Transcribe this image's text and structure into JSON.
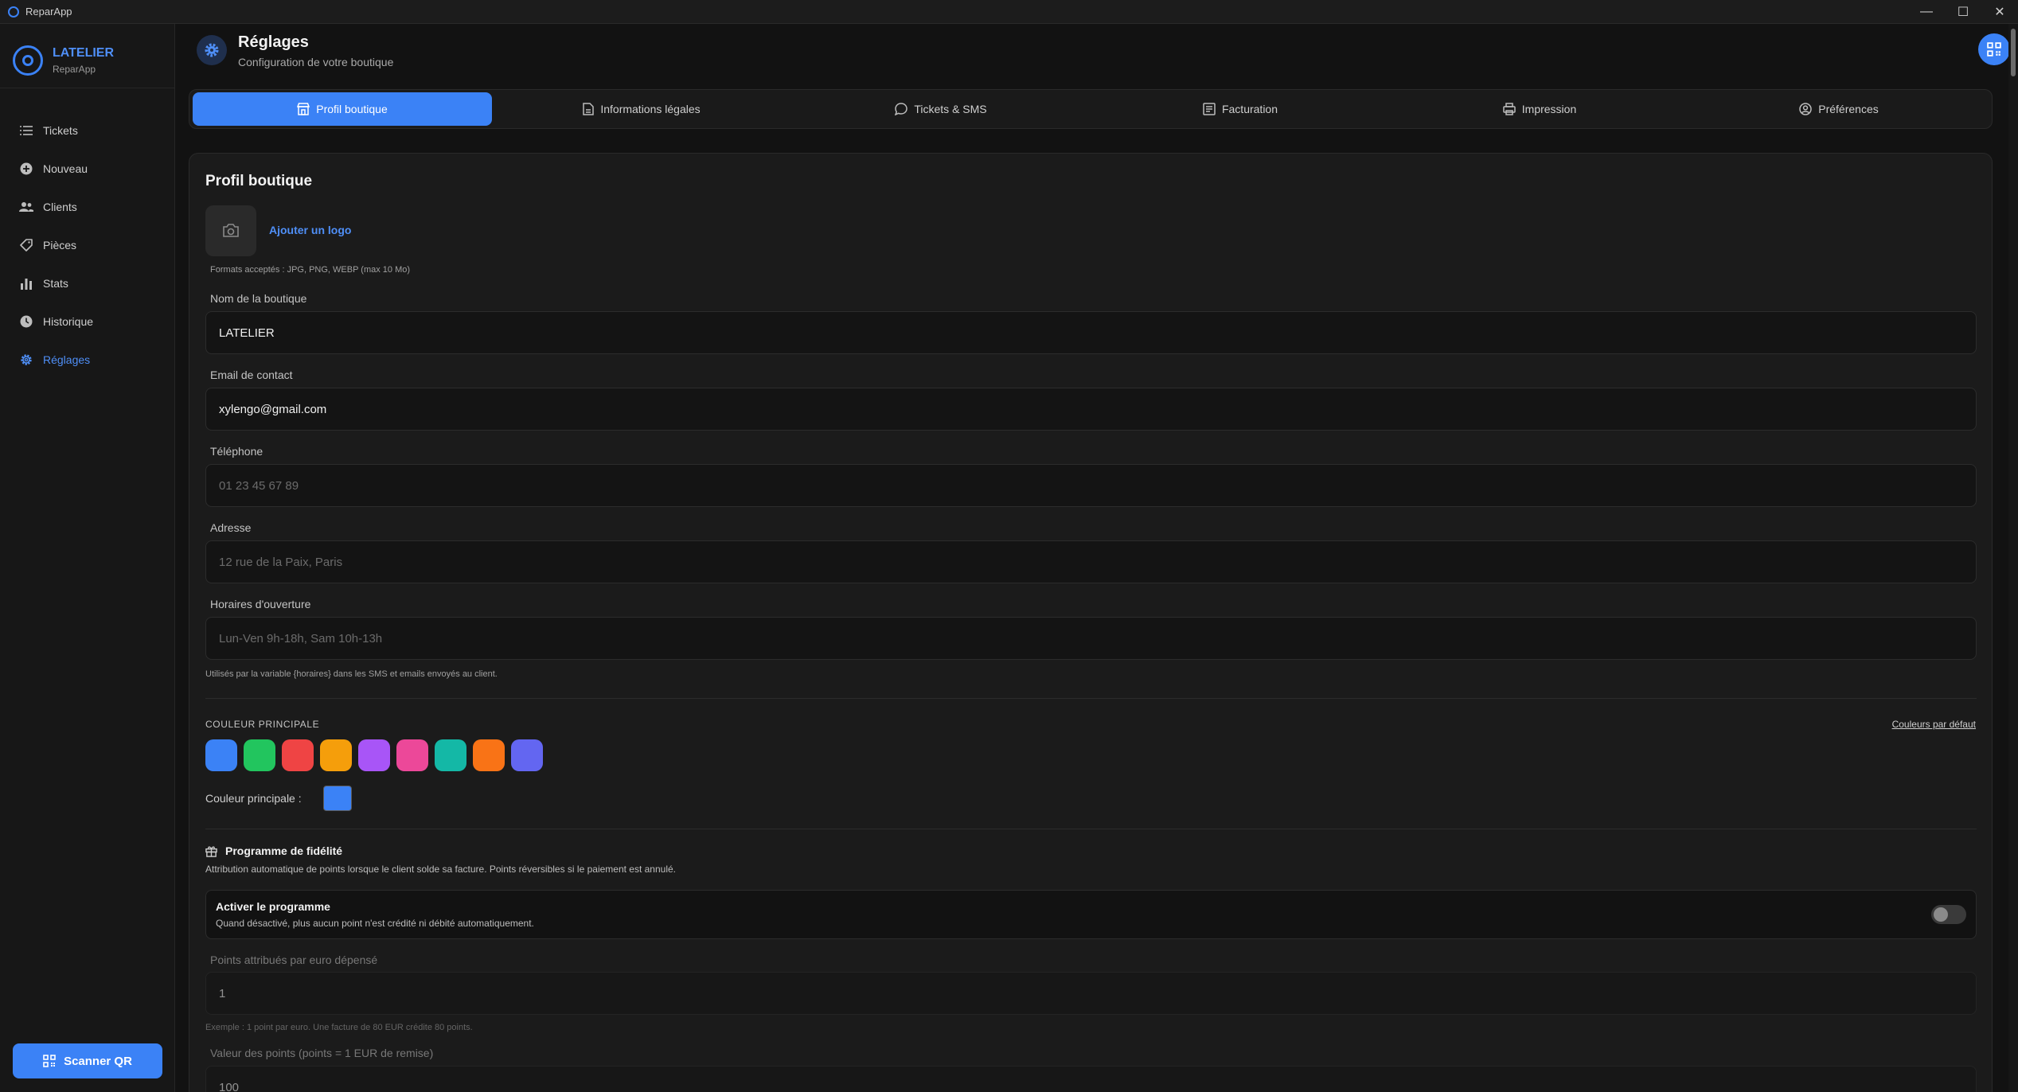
{
  "window": {
    "title": "ReparApp",
    "controls": {
      "minimize": "—",
      "maximize": "☐",
      "close": "✕"
    }
  },
  "brand": {
    "name": "LATELIER",
    "sub": "ReparApp"
  },
  "nav": [
    {
      "label": "Tickets",
      "icon": "list-icon"
    },
    {
      "label": "Nouveau",
      "icon": "plus-circle-icon"
    },
    {
      "label": "Clients",
      "icon": "users-icon"
    },
    {
      "label": "Pièces",
      "icon": "tag-icon"
    },
    {
      "label": "Stats",
      "icon": "bar-chart-icon"
    },
    {
      "label": "Historique",
      "icon": "clock-icon"
    },
    {
      "label": "Réglages",
      "icon": "gear-icon",
      "active": true
    }
  ],
  "scan_button": "Scanner QR",
  "header": {
    "title": "Réglages",
    "subtitle": "Configuration de votre boutique"
  },
  "tabs": [
    {
      "label": "Profil boutique",
      "active": true
    },
    {
      "label": "Informations légales"
    },
    {
      "label": "Tickets & SMS"
    },
    {
      "label": "Facturation"
    },
    {
      "label": "Impression"
    },
    {
      "label": "Préférences"
    }
  ],
  "profile": {
    "title": "Profil boutique",
    "add_logo": "Ajouter un logo",
    "formats": "Formats acceptés : JPG, PNG, WEBP (max 10 Mo)",
    "fields": {
      "name": {
        "label": "Nom de la boutique",
        "value": "LATELIER",
        "placeholder": ""
      },
      "email": {
        "label": "Email de contact",
        "value": "xylengo@gmail.com",
        "placeholder": ""
      },
      "phone": {
        "label": "Téléphone",
        "value": "",
        "placeholder": "01 23 45 67 89"
      },
      "address": {
        "label": "Adresse",
        "value": "",
        "placeholder": "12 rue de la Paix, Paris"
      },
      "hours": {
        "label": "Horaires d'ouverture",
        "value": "",
        "placeholder": "Lun-Ven 9h-18h, Sam 10h-13h"
      }
    },
    "hours_hint": "Utilisés par la variable {horaires} dans les SMS et emails envoyés au client."
  },
  "color": {
    "section_label": "COULEUR PRINCIPALE",
    "reset": "Couleurs par défaut",
    "swatches": [
      "#3b82f6",
      "#22c55e",
      "#ef4444",
      "#f59e0b",
      "#a855f7",
      "#ec4899",
      "#14b8a6",
      "#f97316",
      "#6366f1"
    ],
    "current_label": "Couleur principale :",
    "current": "#3b82f6"
  },
  "loyalty": {
    "title": "Programme de fidélité",
    "description": "Attribution automatique de points lorsque le client solde sa facture. Points réversibles si le paiement est annulé.",
    "toggle_title": "Activer le programme",
    "toggle_desc": "Quand désactivé, plus aucun point n'est crédité ni débité automatiquement.",
    "enabled": false,
    "points_label": "Points attribués par euro dépensé",
    "points_value": "1",
    "points_hint": "Exemple : 1 point par euro. Une facture de 80 EUR crédite 80 points.",
    "value_label": "Valeur des points (points = 1 EUR de remise)",
    "value_value": "100"
  }
}
